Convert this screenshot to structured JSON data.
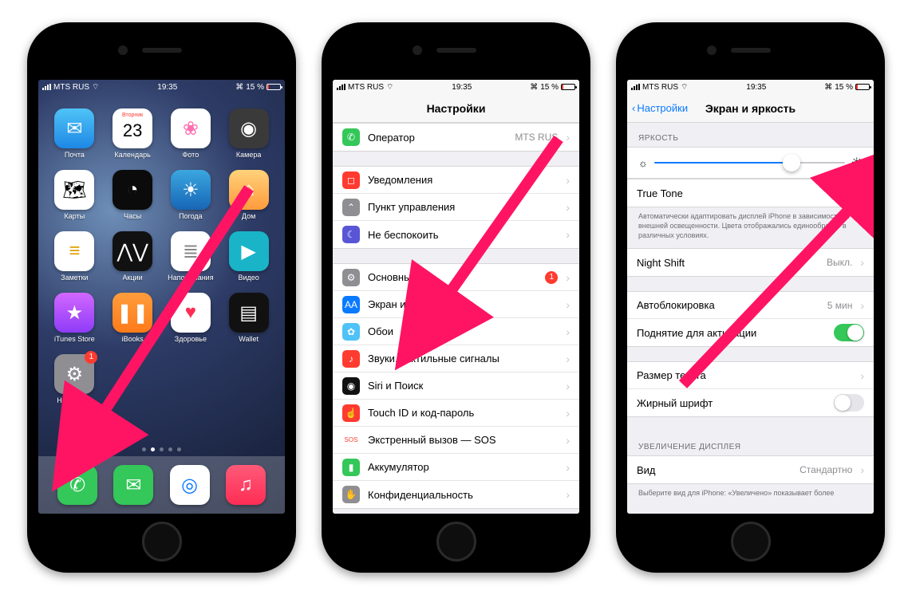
{
  "statusbar": {
    "carrier": "MTS RUS",
    "time": "19:35",
    "battery_pct": "15 %"
  },
  "home": {
    "apps": [
      {
        "label": "Почта",
        "bg": "linear-gradient(#4fc3f7,#1e88e5)",
        "glyph": "✉"
      },
      {
        "label": "Календарь",
        "bg": "#fff",
        "glyph": "23",
        "fg": "#000",
        "top": "Вторник"
      },
      {
        "label": "Фото",
        "bg": "#fff",
        "glyph": "❀",
        "fg": "#ff6fae"
      },
      {
        "label": "Камера",
        "bg": "#3a3a3a",
        "glyph": "◉"
      },
      {
        "label": "Карты",
        "bg": "#fff",
        "glyph": "🗺",
        "fg": "#000"
      },
      {
        "label": "Часы",
        "bg": "#0b0b0b",
        "glyph": "◔"
      },
      {
        "label": "Погода",
        "bg": "linear-gradient(#3ba7e0,#1766b5)",
        "glyph": "☀"
      },
      {
        "label": "Дом",
        "bg": "linear-gradient(#ffd27a,#ff9a3c)",
        "glyph": "⌂"
      },
      {
        "label": "Заметки",
        "bg": "#fff",
        "glyph": "≡",
        "fg": "#e0a100"
      },
      {
        "label": "Акции",
        "bg": "#111",
        "glyph": "⋀⋁"
      },
      {
        "label": "Напоминания",
        "bg": "#fff",
        "glyph": "≣",
        "fg": "#888"
      },
      {
        "label": "Видео",
        "bg": "#19b4c8",
        "glyph": "▶"
      },
      {
        "label": "iTunes Store",
        "bg": "linear-gradient(#d267ff,#8e3cf7)",
        "glyph": "★"
      },
      {
        "label": "iBooks",
        "bg": "linear-gradient(#ff9d3c,#ff7a1a)",
        "glyph": "❚❚"
      },
      {
        "label": "Здоровье",
        "bg": "#fff",
        "glyph": "♥",
        "fg": "#ff2d55"
      },
      {
        "label": "Wallet",
        "bg": "#111",
        "glyph": "▤"
      },
      {
        "label": "Настройки",
        "bg": "#8e8e93",
        "glyph": "⚙",
        "badge": "1"
      }
    ],
    "dock": [
      {
        "label": "Телефон",
        "bg": "#34c759",
        "glyph": "✆"
      },
      {
        "label": "Сообщения",
        "bg": "#34c759",
        "glyph": "✉"
      },
      {
        "label": "Safari",
        "bg": "#fff",
        "glyph": "◎",
        "fg": "#0a7aff"
      },
      {
        "label": "Музыка",
        "bg": "linear-gradient(#ff5a78,#ff2d55)",
        "glyph": "♫"
      }
    ]
  },
  "settings": {
    "title": "Настройки",
    "groups": [
      [
        {
          "icon_bg": "#34c759",
          "glyph": "✆",
          "label": "Оператор",
          "value": "MTS RUS"
        }
      ],
      [
        {
          "icon_bg": "#ff3b30",
          "glyph": "◻",
          "label": "Уведомления"
        },
        {
          "icon_bg": "#8e8e93",
          "glyph": "⌃",
          "label": "Пункт управления"
        },
        {
          "icon_bg": "#5856d6",
          "glyph": "☾",
          "label": "Не беспокоить"
        }
      ],
      [
        {
          "icon_bg": "#8e8e93",
          "glyph": "⚙",
          "label": "Основные",
          "badge": "1"
        },
        {
          "icon_bg": "#0a7aff",
          "glyph": "AA",
          "label": "Экран и яркость"
        },
        {
          "icon_bg": "#4fc3f7",
          "glyph": "✿",
          "label": "Обои"
        },
        {
          "icon_bg": "#ff3b30",
          "glyph": "♪",
          "label": "Звуки, тактильные сигналы"
        },
        {
          "icon_bg": "#111",
          "glyph": "◉",
          "label": "Siri и Поиск"
        },
        {
          "icon_bg": "#ff3b30",
          "glyph": "☝",
          "label": "Touch ID и код-пароль"
        },
        {
          "icon_bg": "#fff",
          "glyph": "SOS",
          "fg": "#ff3b30",
          "label": "Экстренный вызов — SOS"
        },
        {
          "icon_bg": "#34c759",
          "glyph": "▮",
          "label": "Аккумулятор"
        },
        {
          "icon_bg": "#8e8e93",
          "glyph": "✋",
          "label": "Конфиденциальность"
        }
      ]
    ]
  },
  "display": {
    "back": "Настройки",
    "title": "Экран и яркость",
    "brightness_header": "ЯРКОСТЬ",
    "brightness_pct": 72,
    "truetone_label": "True Tone",
    "truetone_on": true,
    "truetone_foot": "Автоматически адаптировать дисплей iPhone в зависимости от внешней освещенности. Цвета отображались единообразно в различных условиях.",
    "nightshift_label": "Night Shift",
    "nightshift_value": "Выкл.",
    "autolock_label": "Автоблокировка",
    "autolock_value": "5 мин",
    "raise_label": "Поднятие для активации",
    "raise_on": true,
    "textsize_label": "Размер текста",
    "bold_label": "Жирный шрифт",
    "bold_on": false,
    "zoom_header": "УВЕЛИЧЕНИЕ ДИСПЛЕЯ",
    "zoom_label": "Вид",
    "zoom_value": "Стандартно",
    "zoom_foot": "Выберите вид для iPhone: «Увеличено» показывает более"
  }
}
